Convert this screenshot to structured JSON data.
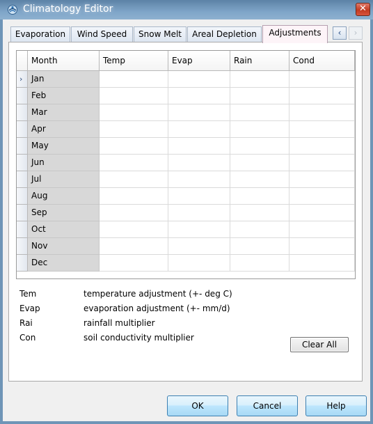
{
  "window": {
    "title": "Climatology Editor",
    "close_glyph": "✕",
    "app_icon": "climatology-app-icon",
    "accent_color": "#6f95b7"
  },
  "tabs": [
    {
      "label": "Evaporation",
      "active": false
    },
    {
      "label": "Wind Speed",
      "active": false
    },
    {
      "label": "Snow Melt",
      "active": false
    },
    {
      "label": "Areal Depletion",
      "active": false
    },
    {
      "label": "Adjustments",
      "active": true
    }
  ],
  "tab_scroll": {
    "left_glyph": "‹",
    "right_glyph": "›"
  },
  "grid": {
    "columns": [
      "Month",
      "Temp",
      "Evap",
      "Rain",
      "Cond"
    ],
    "current_row_marker": "›",
    "rows": [
      {
        "month": "Jan",
        "temp": "",
        "evap": "",
        "rain": "",
        "cond": ""
      },
      {
        "month": "Feb",
        "temp": "",
        "evap": "",
        "rain": "",
        "cond": ""
      },
      {
        "month": "Mar",
        "temp": "",
        "evap": "",
        "rain": "",
        "cond": ""
      },
      {
        "month": "Apr",
        "temp": "",
        "evap": "",
        "rain": "",
        "cond": ""
      },
      {
        "month": "May",
        "temp": "",
        "evap": "",
        "rain": "",
        "cond": ""
      },
      {
        "month": "Jun",
        "temp": "",
        "evap": "",
        "rain": "",
        "cond": ""
      },
      {
        "month": "Jul",
        "temp": "",
        "evap": "",
        "rain": "",
        "cond": ""
      },
      {
        "month": "Aug",
        "temp": "",
        "evap": "",
        "rain": "",
        "cond": ""
      },
      {
        "month": "Sep",
        "temp": "",
        "evap": "",
        "rain": "",
        "cond": ""
      },
      {
        "month": "Oct",
        "temp": "",
        "evap": "",
        "rain": "",
        "cond": ""
      },
      {
        "month": "Nov",
        "temp": "",
        "evap": "",
        "rain": "",
        "cond": ""
      },
      {
        "month": "Dec",
        "temp": "",
        "evap": "",
        "rain": "",
        "cond": ""
      }
    ]
  },
  "legend": [
    {
      "abbr": "Tem",
      "desc": "temperature adjustment (+- deg C)"
    },
    {
      "abbr": "Evap",
      "desc": "evaporation adjustment (+- mm/d)"
    },
    {
      "abbr": "Rai",
      "desc": "rainfall multiplier"
    },
    {
      "abbr": "Con",
      "desc": "soil conductivity multiplier"
    }
  ],
  "buttons": {
    "clear_all": "Clear All",
    "ok": "OK",
    "cancel": "Cancel",
    "help": "Help"
  }
}
